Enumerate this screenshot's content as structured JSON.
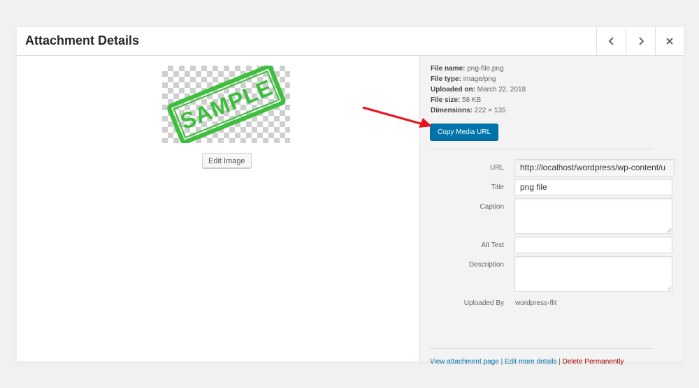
{
  "header": {
    "title": "Attachment Details"
  },
  "icons": {
    "prev": "chevron-left-icon",
    "next": "chevron-right-icon",
    "close": "close-icon"
  },
  "preview": {
    "stamp_text": "SAMPLE",
    "edit_button_label": "Edit Image"
  },
  "file_info": {
    "name_label": "File name:",
    "name_value": "png-file.png",
    "type_label": "File type:",
    "type_value": "image/png",
    "uploaded_label": "Uploaded on:",
    "uploaded_value": "March 22, 2018",
    "size_label": "File size:",
    "size_value": "58 KB",
    "dimensions_label": "Dimensions:",
    "dimensions_value": "222 × 135"
  },
  "copy_button_label": "Copy Media URL",
  "fields": {
    "url_label": "URL",
    "url_value": "http://localhost/wordpress/wp-content/u",
    "title_label": "Title",
    "title_value": "png file",
    "caption_label": "Caption",
    "caption_value": "",
    "alt_label": "Alt Text",
    "alt_value": "",
    "description_label": "Description",
    "description_value": "",
    "uploaded_by_label": "Uploaded By",
    "uploaded_by_value": "wordpress-flit"
  },
  "links": {
    "view": "View attachment page",
    "sep1": "|",
    "edit": "Edit more details",
    "sep2": "|",
    "delete": "Delete Permanently"
  },
  "colors": {
    "primary_button": "#0073aa",
    "link": "#0073aa",
    "delete_link": "#aa0000",
    "stamp_green": "#3cbf3c",
    "annotation_arrow": "#e8141c"
  }
}
